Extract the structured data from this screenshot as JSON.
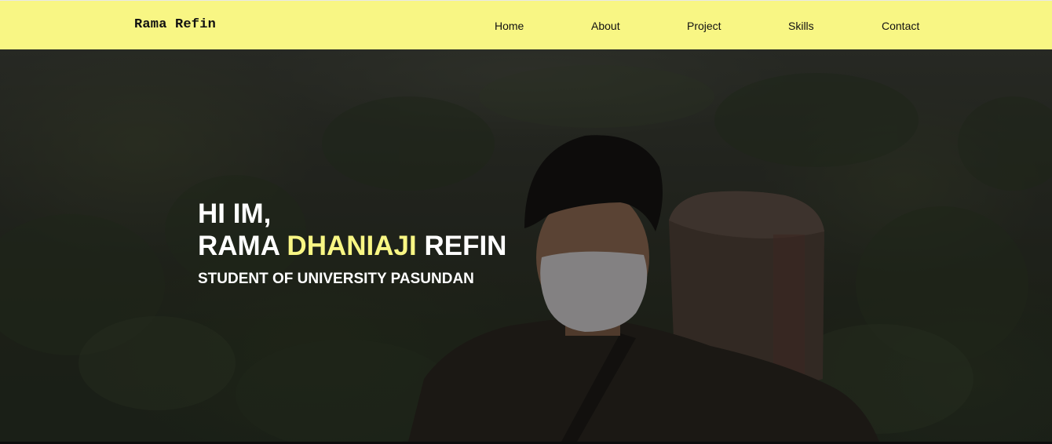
{
  "navbar": {
    "brand": "Rama Refin",
    "links": [
      {
        "label": "Home"
      },
      {
        "label": "About"
      },
      {
        "label": "Project"
      },
      {
        "label": "Skills"
      },
      {
        "label": "Contact"
      }
    ]
  },
  "hero": {
    "greeting": "HI IM,",
    "name_first": "RAMA",
    "name_middle": "DHANIAJI",
    "name_last": "REFIN",
    "subtitle": "STUDENT OF UNIVERSITY PASUNDAN"
  },
  "colors": {
    "navbar_bg": "#f8f684",
    "accent": "#f8f684",
    "hero_text": "#ffffff",
    "nav_text": "#111111"
  }
}
